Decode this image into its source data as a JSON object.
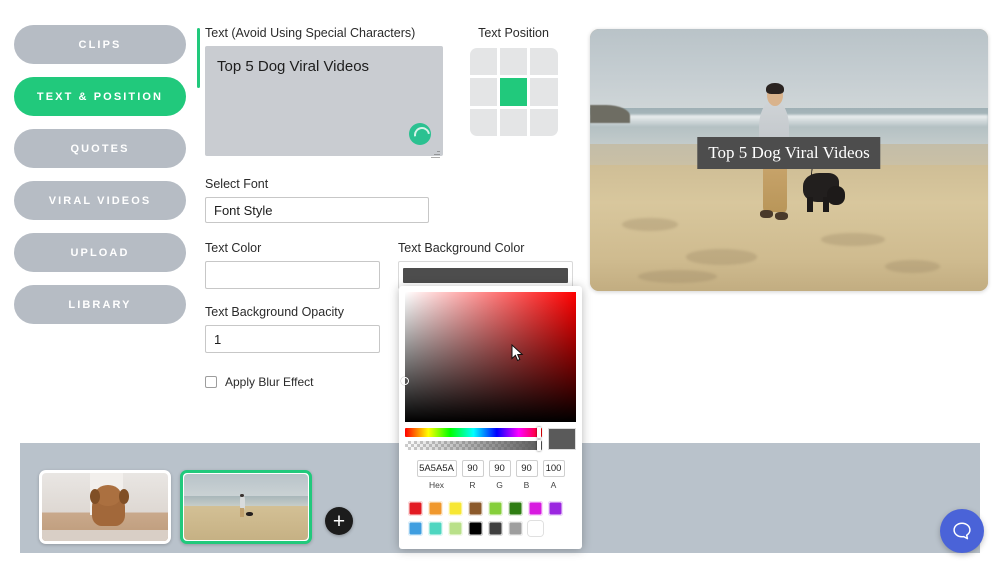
{
  "sidebar": {
    "items": [
      {
        "label": "CLIPS",
        "active": false
      },
      {
        "label": "TEXT & POSITION",
        "active": true
      },
      {
        "label": "QUOTES",
        "active": false
      },
      {
        "label": "VIRAL VIDEOS",
        "active": false
      },
      {
        "label": "UPLOAD",
        "active": false
      },
      {
        "label": "LIBRARY",
        "active": false
      }
    ]
  },
  "form": {
    "text_label": "Text (Avoid Using Special Characters)",
    "text_value": "Top 5 Dog Viral Videos",
    "spinner_icon": "loading-spinner-icon",
    "resize_grip_icon": "resize-grip-icon",
    "position_label": "Text Position",
    "position_selected_index": 4,
    "select_font_label": "Select Font",
    "font_value": "Font Style",
    "text_color_label": "Text Color",
    "text_color_value": "",
    "text_bg_color_label": "Text Background Color",
    "text_bg_color_value": "#4d4d4d",
    "opacity_label": "Text Background Opacity",
    "opacity_value": "1",
    "blur_label": "Apply Blur Effect",
    "blur_checked": false
  },
  "color_picker": {
    "hex_value": "5A5A5A",
    "hex_caption": "Hex",
    "r_value": "90",
    "r_caption": "R",
    "g_value": "90",
    "g_caption": "G",
    "b_value": "90",
    "b_caption": "B",
    "a_value": "100",
    "a_caption": "A",
    "preview_color": "#5a5a5a",
    "cursor_icon": "mouse-pointer-icon",
    "palette_row_1": [
      "#e31b23",
      "#f0982d",
      "#f7e733",
      "#8c5a2b",
      "#86cf3b",
      "#2e7d12",
      "#d81ae0",
      "#9b27e0"
    ],
    "palette_row_2": [
      "#3f9ee0",
      "#4ed6c0",
      "#b9e089",
      "#000000",
      "#3f3f3f",
      "#9e9e9e",
      "#ffffff"
    ]
  },
  "preview": {
    "caption": "Top 5 Dog Viral Videos",
    "caption_bg": "#4d4d4d",
    "scene_description": "beach-scene-man-walking-dog"
  },
  "timeline": {
    "clips": [
      {
        "name": "puppy-clip",
        "selected": false
      },
      {
        "name": "beach-dog-clip",
        "selected": true
      }
    ],
    "add_label": "+",
    "add_icon": "plus-icon"
  },
  "help": {
    "icon": "chat-bubble-icon",
    "accent": "#4a63d8"
  },
  "theme": {
    "accent_green": "#21c97c",
    "nav_inactive": "#b6bcc4",
    "timeline_bg": "#b9c2cb"
  }
}
